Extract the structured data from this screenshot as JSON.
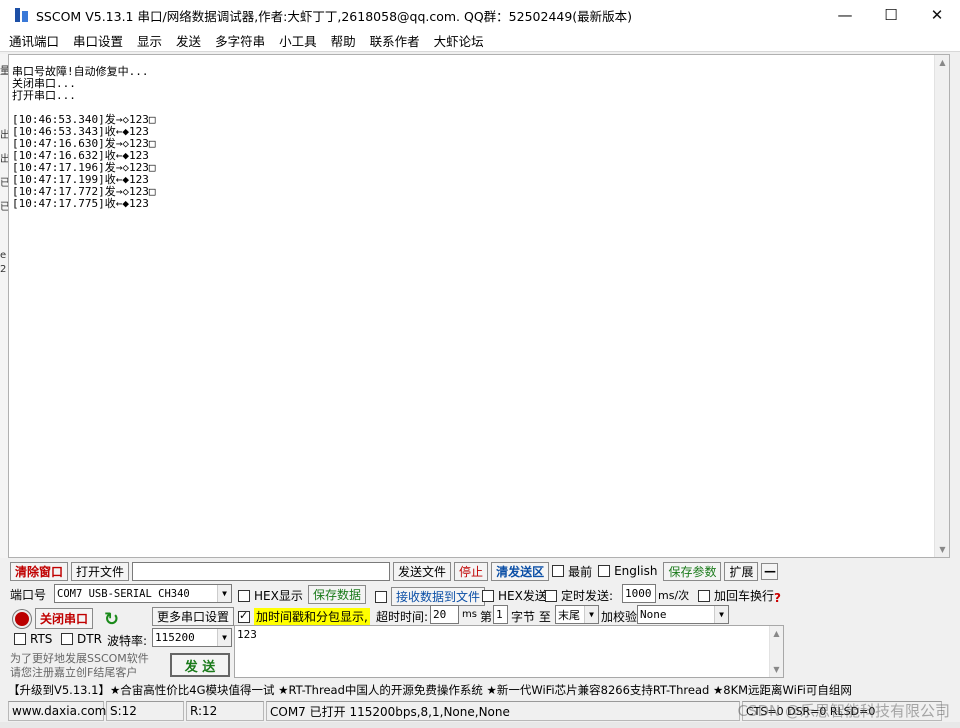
{
  "window": {
    "title": "SSCOM V5.13.1 串口/网络数据调试器,作者:大虾丁丁,2618058@qq.com. QQ群：52502449(最新版本)",
    "controls": [
      "—",
      "☐",
      "✕"
    ]
  },
  "menu": [
    "通讯端口",
    "串口设置",
    "显示",
    "发送",
    "多字符串",
    "小工具",
    "帮助",
    "联系作者",
    "大虾论坛"
  ],
  "output": {
    "lines": [
      "串口号故障!自动修复中...",
      "关闭串口...",
      "打开串口...",
      "",
      "[10:46:53.340]发→◇123□",
      "[10:46:53.343]收←◆123",
      "[10:47:16.630]发→◇123□",
      "[10:47:16.632]收←◆123",
      "[10:47:17.196]发→◇123□",
      "[10:47:17.199]收←◆123",
      "[10:47:17.772]发→◇123□",
      "[10:47:17.775]收←◆123"
    ],
    "left_strip_chars": [
      "量",
      "出",
      "出",
      "已",
      "已",
      "e",
      "2"
    ]
  },
  "toolbar": {
    "clear_window": "清除窗口",
    "open_file": "打开文件",
    "file_path": "",
    "send_file": "发送文件",
    "stop": "停止",
    "clear_send": "清发送区",
    "topmost": "最前",
    "english": "English",
    "save_params": "保存参数",
    "expand": "扩展",
    "collapse": "—"
  },
  "port_panel": {
    "port_label": "端口号",
    "port_value": "COM7 USB-SERIAL CH340",
    "close_port": "关闭串口",
    "more_settings": "更多串口设置",
    "rts": "RTS",
    "dtr": "DTR",
    "baud_label": "波特率:",
    "baud_value": "115200",
    "promo_line1": "为了更好地发展SSCOM软件",
    "promo_line2": "请您注册嘉立创F结尾客户",
    "send_button": "发 送"
  },
  "send_panel": {
    "hex_display": "HEX显示",
    "save_data": "保存数据",
    "recv_to_file": "接收数据到文件",
    "hex_send": "HEX发送",
    "timed_send": "定时发送:",
    "interval": "1000",
    "interval_unit": "ms/次",
    "add_crlf": "加回车换行",
    "help": "?",
    "timestamp": "加时间戳和分包显示,",
    "timeout_label": "超时时间:",
    "timeout_value": "20",
    "timeout_unit": "ms",
    "nth_label": "第",
    "nth_value": "1",
    "byte_label": "字节 至",
    "end_value": "末尾",
    "checksum_label": "加校验",
    "checksum_value": "None",
    "send_text": "123"
  },
  "promo_bar": "【升级到V5.13.1】★合宙高性价比4G模块值得一试 ★RT-Thread中国人的开源免费操作系统 ★新一代WiFi芯片兼容8266支持RT-Thread ★8KM远距离WiFi可自组网",
  "status": {
    "website": "www.daxia.com",
    "sent": "S:12",
    "received": "R:12",
    "port_status": "COM7 已打开  115200bps,8,1,None,None",
    "lines": "CTS=0 DSR=0 RLSD=0"
  },
  "watermark": "CSDN @乐思智能科技有限公司",
  "colors": {
    "red": "#c00000",
    "blue": "#0b4fa6",
    "green": "#1a7a1a",
    "highlight": "#ffff00"
  }
}
